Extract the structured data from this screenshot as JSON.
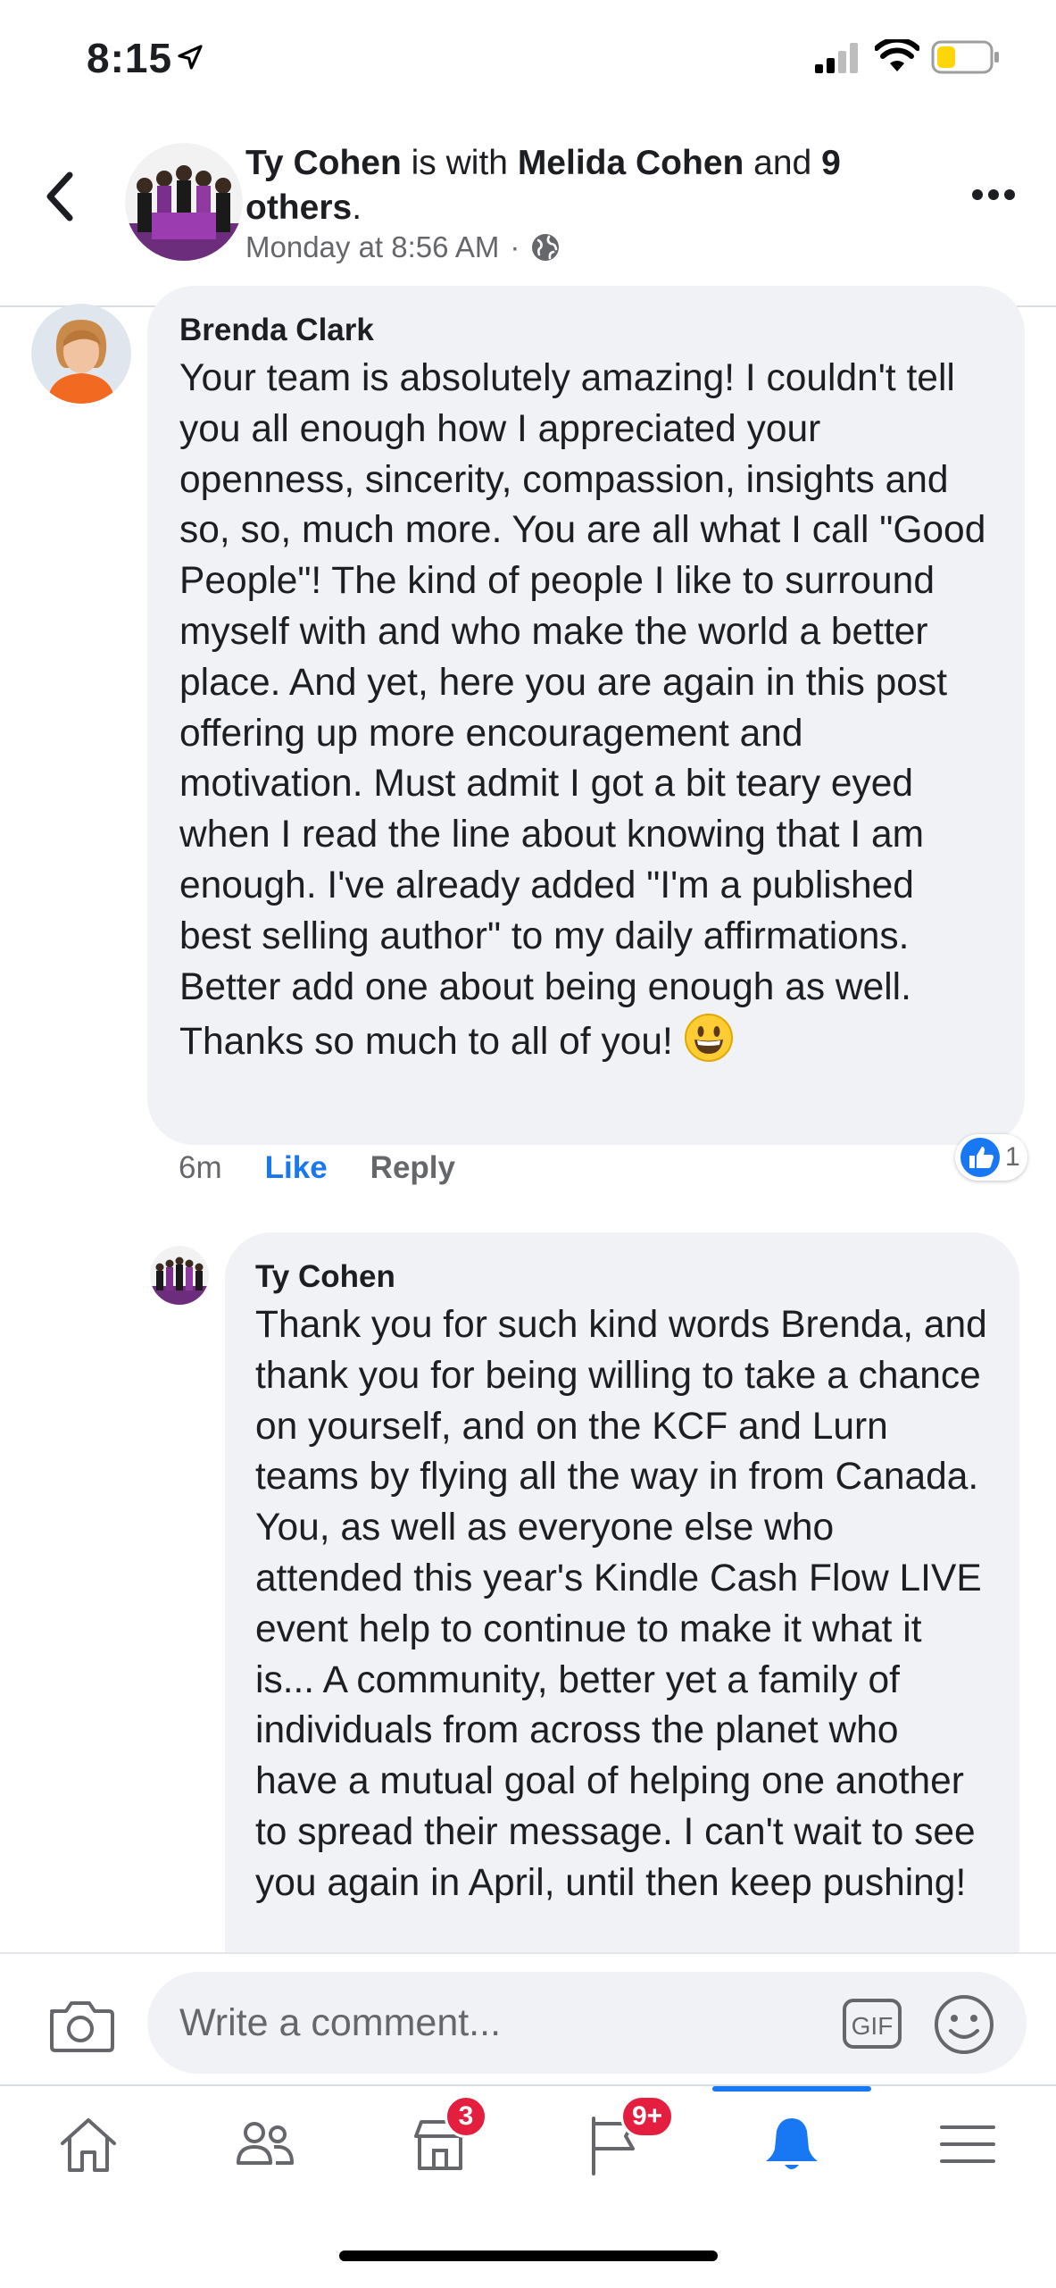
{
  "status_bar": {
    "time": "8:15"
  },
  "post_header": {
    "author": "Ty Cohen",
    "with_text": " is with ",
    "tagged": "Melida Cohen",
    "and_text": " and ",
    "others": "9 others",
    "period": ".",
    "timestamp": "Monday at 8:56 AM",
    "separator": "·"
  },
  "comments": [
    {
      "author": "Brenda Clark",
      "text": "Your team is absolutely amazing!  I couldn't tell you all enough how I appreciated your openness, sincerity, compassion, insights and so, so, much more. You are all what I call \"Good People\"!  The kind of people I like to surround myself with and who make the world a better place. And yet, here you are again in this post offering up more encouragement and motivation.  Must admit I got a bit teary eyed when I read the line about knowing that I am enough.  I've already added \"I'm a published best selling author\" to my daily affirmations.  Better add one about being enough as well.  Thanks so much to all of you! ",
      "time": "6m",
      "like_label": "Like",
      "reply_label": "Reply",
      "reaction_count": "1"
    },
    {
      "author": "Ty Cohen",
      "text": "Thank you for such kind words Brenda, and thank you for being willing to take a chance on yourself, and on the KCF and Lurn teams by flying all the way in from Canada. You, as well as everyone else who attended this year's Kindle Cash Flow LIVE event help to continue to make it what it is... A community, better yet a family of individuals from across the planet who have a mutual goal of helping one another to spread their message. I can't wait to see you again in April, until then keep pushing!"
    }
  ],
  "composer": {
    "placeholder": "Write a comment...",
    "gif_label": "GIF"
  },
  "tabbar": {
    "marketplace_badge": "3",
    "pages_badge": "9+"
  },
  "colors": {
    "accent": "#1877f2",
    "bubble": "#f0f2f5",
    "badge": "#e41e3f",
    "battery": "#ffd60a"
  }
}
